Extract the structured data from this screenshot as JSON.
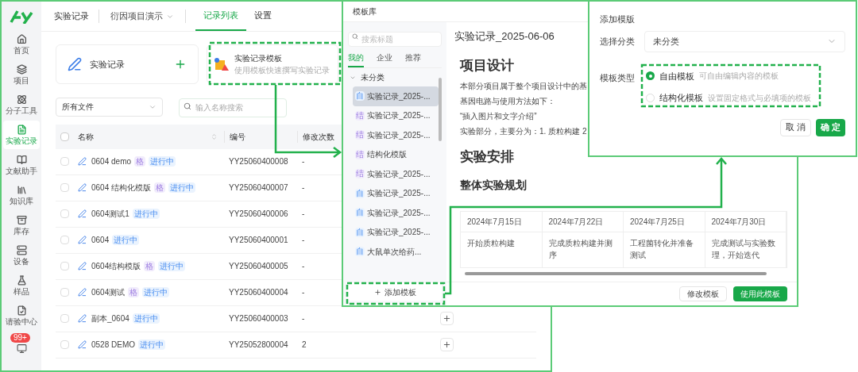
{
  "sidebar": {
    "items": [
      {
        "label": "首页",
        "selected": false
      },
      {
        "label": "项目",
        "selected": false
      },
      {
        "label": "分子工具",
        "selected": false
      },
      {
        "label": "实验记录",
        "selected": true
      },
      {
        "label": "文献助手",
        "selected": false
      },
      {
        "label": "知识库",
        "selected": false
      },
      {
        "label": "库存",
        "selected": false
      },
      {
        "label": "设备",
        "selected": false
      },
      {
        "label": "样品",
        "selected": false
      },
      {
        "label": "请验中心",
        "selected": false
      }
    ],
    "notification_badge": "99+"
  },
  "top_bar": {
    "module": "实验记录",
    "project": "衍因项目演示",
    "tabs": [
      {
        "label": "记录列表",
        "selected": true
      },
      {
        "label": "设置",
        "selected": false
      }
    ]
  },
  "cards": [
    {
      "kind": "new",
      "title": "实验记录"
    },
    {
      "kind": "template",
      "title": "实验记录模板",
      "subtitle": "使用模板快速撰写实验记录"
    }
  ],
  "filter": {
    "scope": "所有文件",
    "search_placeholder": "输入名称搜索"
  },
  "table": {
    "columns": [
      "名称",
      "编号",
      "修改次数"
    ],
    "all_checked": false,
    "rows": [
      {
        "checked": false,
        "name": "0604 demo",
        "tags": [
          {
            "kind": "type",
            "label": "格"
          },
          {
            "kind": "status",
            "label": "进行中"
          }
        ],
        "code": "YY25060400008",
        "edits": "-"
      },
      {
        "checked": false,
        "name": "0604 结构化模版",
        "tags": [
          {
            "kind": "type",
            "label": "格"
          },
          {
            "kind": "status",
            "label": "进行中"
          }
        ],
        "code": "YY25060400007",
        "edits": "-"
      },
      {
        "checked": false,
        "name": "0604测试1",
        "tags": [
          {
            "kind": "status",
            "label": "进行中"
          }
        ],
        "code": "YY25060400006",
        "edits": "-"
      },
      {
        "checked": false,
        "name": "0604",
        "tags": [
          {
            "kind": "status",
            "label": "进行中"
          }
        ],
        "code": "YY25060400001",
        "edits": "-"
      },
      {
        "checked": false,
        "name": "0604结构模版",
        "tags": [
          {
            "kind": "type",
            "label": "格"
          },
          {
            "kind": "status",
            "label": "进行中"
          }
        ],
        "code": "YY25060400005",
        "edits": "-"
      },
      {
        "checked": false,
        "name": "0604测试",
        "tags": [
          {
            "kind": "type",
            "label": "格"
          },
          {
            "kind": "status",
            "label": "进行中"
          }
        ],
        "code": "YY25060400004",
        "edits": "-"
      },
      {
        "checked": false,
        "name": "副本_0604",
        "tags": [
          {
            "kind": "status",
            "label": "进行中"
          }
        ],
        "code": "YY25060400003",
        "edits": "-",
        "add_button": true
      },
      {
        "checked": false,
        "name": "0528 DEMO",
        "tags": [
          {
            "kind": "status",
            "label": "进行中"
          }
        ],
        "code": "YY25052800004",
        "edits": "2",
        "add_button": true
      }
    ]
  },
  "template_library": {
    "title": "模板库",
    "search_placeholder": "搜索标题",
    "tabs": [
      {
        "label": "我的",
        "selected": true
      },
      {
        "label": "企业",
        "selected": false
      },
      {
        "label": "推荐",
        "selected": false
      }
    ],
    "tree": [
      {
        "label": "未分类",
        "expanded": true,
        "children": [
          {
            "kind": "free",
            "badge": "自",
            "label": "实验记录_2025-...",
            "selected": true
          },
          {
            "kind": "structured",
            "badge": "结",
            "label": "实验记录_2025-...",
            "selected": false
          },
          {
            "kind": "structured",
            "badge": "结",
            "label": "实验记录_2025-...",
            "selected": false
          },
          {
            "kind": "structured",
            "badge": "结",
            "label": "结构化模版",
            "selected": false
          },
          {
            "kind": "structured",
            "badge": "结",
            "label": "实验记录_2025-...",
            "selected": false
          },
          {
            "kind": "free",
            "badge": "自",
            "label": "实验记录_2025-...",
            "selected": false
          },
          {
            "kind": "free",
            "badge": "自",
            "label": "实验记录_2025-...",
            "selected": false
          },
          {
            "kind": "free",
            "badge": "自",
            "label": "实验记录_2025-...",
            "selected": false
          },
          {
            "kind": "free",
            "badge": "自",
            "label": "大鼠单次给药...",
            "selected": false
          }
        ]
      }
    ],
    "add_button": "添加模板",
    "preview": {
      "title": "实验记录_2025-06-06",
      "blocks": [
        {
          "kind": "h1",
          "text": "项目设计"
        },
        {
          "kind": "p",
          "text": "本部分项目属于整个项目设计中的基"
        },
        {
          "kind": "p",
          "text": "基因电路与使用方法如下："
        },
        {
          "kind": "p",
          "text": "“插入图片和文字介绍”"
        },
        {
          "kind": "p",
          "text": "实验部分，主要分为：1. 质粒构建 2"
        },
        {
          "kind": "h1",
          "text": "实验安排"
        },
        {
          "kind": "h2",
          "text": "整体实验规划"
        }
      ],
      "table": [
        [
          "2024年7月15日",
          "2024年7月22日",
          "2024年7月25日",
          "2024年7月30日"
        ],
        [
          "开始质粒构建",
          "完成质粒构建并测序",
          "工程菌转化并准备测试",
          "完成测试与实验数理，开始迭代"
        ]
      ]
    },
    "buttons": [
      {
        "kind": "secondary",
        "label": "修改模板"
      },
      {
        "kind": "primary",
        "label": "使用此模板"
      }
    ]
  },
  "add_template_dialog": {
    "title": "添加模版",
    "category_label": "选择分类",
    "category_value": "未分类",
    "type_label": "模板类型",
    "types": [
      {
        "label": "自由模板",
        "hint": "可自由编辑内容的模板",
        "selected": true
      },
      {
        "label": "结构化模板",
        "hint": "设置固定格式与必填项的模板",
        "selected": false
      }
    ],
    "buttons": [
      {
        "kind": "secondary",
        "label": "取 消"
      },
      {
        "kind": "primary",
        "label": "确 定"
      }
    ]
  }
}
